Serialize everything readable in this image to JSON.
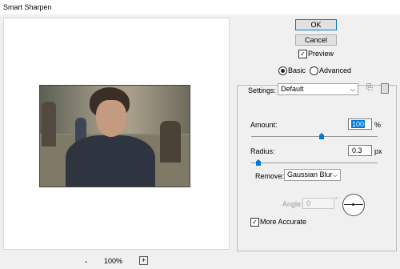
{
  "window": {
    "title": "Smart Sharpen"
  },
  "preview": {
    "zoom_label": "100%",
    "zoom_out_symbol": "-",
    "zoom_in_symbol": "+"
  },
  "buttons": {
    "ok": "OK",
    "cancel": "Cancel"
  },
  "preview_toggle": {
    "label": "Preview",
    "checked": true
  },
  "mode": {
    "basic": "Basic",
    "advanced": "Advanced",
    "selected": "Basic"
  },
  "settings": {
    "label": "Settings:",
    "value": "Default"
  },
  "amount": {
    "label": "Amount:",
    "value": "100",
    "unit": "%"
  },
  "radius": {
    "label": "Radius:",
    "value": "0.3",
    "unit": "px"
  },
  "remove": {
    "label": "Remove:",
    "value": "Gaussian Blur"
  },
  "angle": {
    "label": "Angle:",
    "value": "0",
    "unit": "°"
  },
  "more_accurate": {
    "label": "More Accurate",
    "checked": true
  },
  "colors": {
    "accent": "#0078d7"
  }
}
